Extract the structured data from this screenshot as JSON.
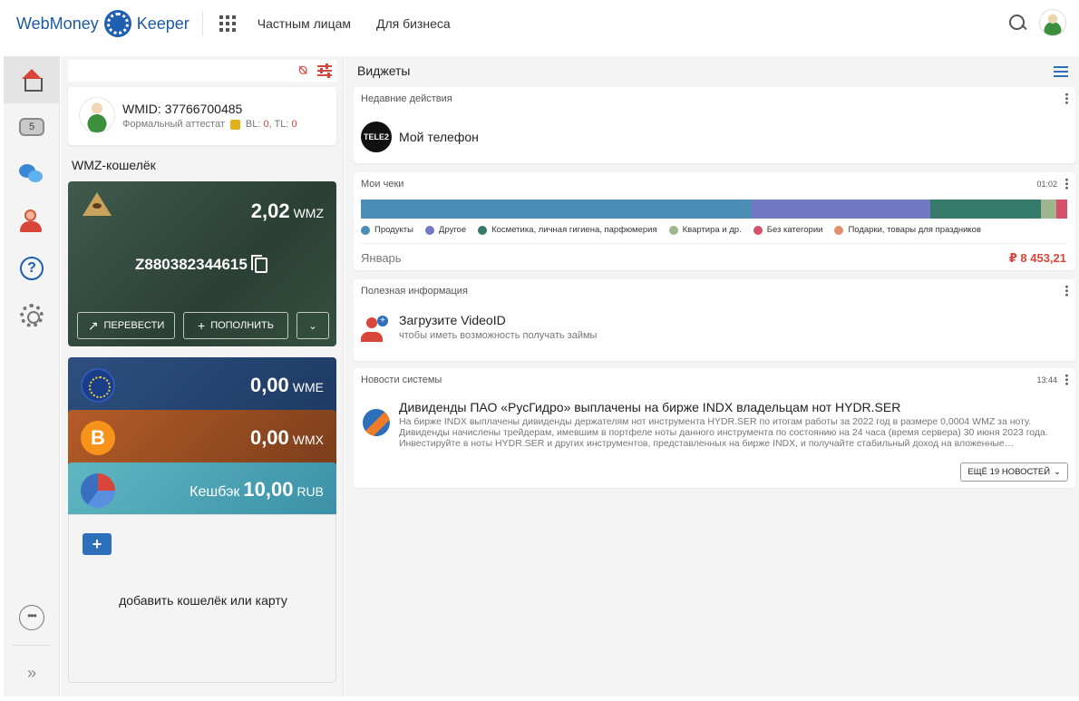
{
  "header": {
    "logo_left": "WebMoney",
    "logo_right": "Keeper",
    "nav": [
      "Частным лицам",
      "Для бизнеса"
    ]
  },
  "sidebar": {
    "items": [
      "home-icon",
      "coins-icon",
      "chat-icon",
      "contacts-icon",
      "help-icon",
      "settings-icon"
    ],
    "coin_badge": "5"
  },
  "profile": {
    "wmid": "WMID: 37766700485",
    "attest": "Формальный аттестат",
    "bl_label": "BL:",
    "bl_value": "0",
    "tl_label": "TL:",
    "tl_value": "0"
  },
  "wallet_heading": "WMZ-кошелёк",
  "wallets": {
    "wmz": {
      "amount": "2,02",
      "currency": "WMZ",
      "number": "Z880382344615",
      "transfer": "ПЕРЕВЕСТИ",
      "topup": "ПОПОЛНИТЬ"
    },
    "wme": {
      "amount": "0,00",
      "currency": "WME"
    },
    "wmx": {
      "amount": "0,00",
      "currency": "WMX"
    },
    "cashback": {
      "label": "Кешбэк",
      "amount": "10,00",
      "currency": "RUB"
    }
  },
  "add_wallet": "добавить кошелёк или карту",
  "widgets": {
    "title": "Виджеты",
    "recent": {
      "heading": "Недавние действия",
      "logo_text": "TELE2",
      "item": "Мой телефон"
    },
    "checks": {
      "heading": "Мои чеки",
      "time": "01:02",
      "month": "Январь",
      "total": "₽ 8 453,21",
      "segments": [
        {
          "name": "Продукты",
          "color": "#4a8db5",
          "share": 0.553
        },
        {
          "name": "Другое",
          "color": "#7178c4",
          "share": 0.253
        },
        {
          "name": "Косметика, личная гигиена, парфюмерия",
          "color": "#367a6c",
          "share": 0.157
        },
        {
          "name": "Квартира и др.",
          "color": "#9fb58e",
          "share": 0.022
        },
        {
          "name": "Без категории",
          "color": "#d4506b",
          "share": 0.015
        },
        {
          "name": "Подарки, товары для праздников",
          "color": "#e0916a",
          "share": 0.0
        }
      ]
    },
    "info": {
      "heading": "Полезная информация",
      "title": "Загрузите VideoID",
      "subtitle": "чтобы иметь возможность получать займы",
      "icon_label": "VIDEO"
    },
    "news": {
      "heading": "Новости системы",
      "time": "13:44",
      "title": "Дивиденды ПАО «РусГидро» выплачены на бирже INDX владельцам нот HYDR.SER",
      "text": "На бирже INDX выплачены дивиденды держателям нот инструмента HYDR.SER по итогам работы за 2022 год в размере 0,0004 WMZ за ноту. Дивиденды начислены трейдерам, имевшим в портфеле ноты данного инструмента по состоянию на 24 часа (время сервера) 30 июня 2023 года. Инвестируйте в ноты HYDR.SER и других инструментов, представленных на бирже INDX, и получайте стабильный доход на вложенные…",
      "more": "ЕЩЁ 19 НОВОСТЕЙ"
    }
  }
}
